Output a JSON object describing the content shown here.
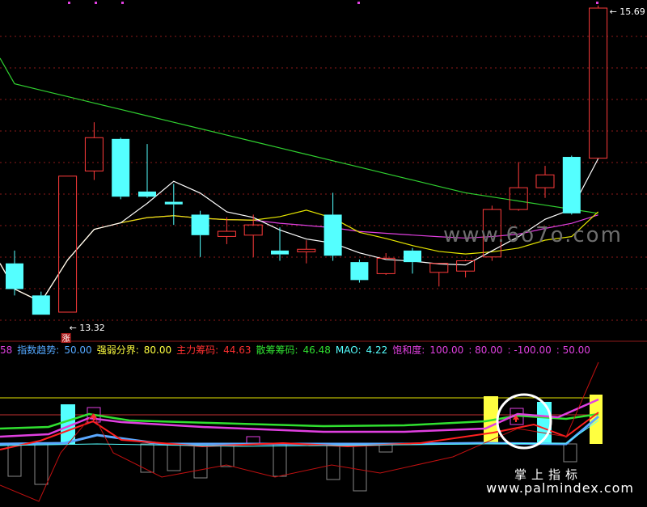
{
  "chart_data": [
    {
      "type": "candlestick",
      "title": "",
      "price_labels": {
        "high_marker": "15.69",
        "low_marker": "13.32"
      },
      "low_badge": "涨",
      "candles": [
        {
          "o": 13.7,
          "c": 13.5,
          "h": 13.8,
          "l": 13.45,
          "dir": "down"
        },
        {
          "o": 13.45,
          "c": 13.3,
          "h": 13.48,
          "l": 13.3,
          "dir": "down"
        },
        {
          "o": 13.32,
          "c": 14.38,
          "h": 14.38,
          "l": 13.32,
          "dir": "up"
        },
        {
          "o": 14.42,
          "c": 14.68,
          "h": 14.8,
          "l": 14.35,
          "dir": "up"
        },
        {
          "o": 14.67,
          "c": 14.22,
          "h": 14.68,
          "l": 14.2,
          "dir": "down"
        },
        {
          "o": 14.22,
          "c": 14.26,
          "h": 14.63,
          "l": 14.21,
          "dir": "down"
        },
        {
          "o": 14.18,
          "c": 14.16,
          "h": 14.32,
          "l": 14.0,
          "dir": "down"
        },
        {
          "o": 14.08,
          "c": 13.92,
          "h": 14.11,
          "l": 13.75,
          "dir": "down"
        },
        {
          "o": 13.91,
          "c": 13.95,
          "h": 14.06,
          "l": 13.85,
          "dir": "up"
        },
        {
          "o": 13.92,
          "c": 14.0,
          "h": 14.08,
          "l": 13.75,
          "dir": "up"
        },
        {
          "o": 13.8,
          "c": 13.77,
          "h": 13.98,
          "l": 13.72,
          "dir": "down"
        },
        {
          "o": 13.79,
          "c": 13.81,
          "h": 13.88,
          "l": 13.7,
          "dir": "up"
        },
        {
          "o": 14.08,
          "c": 13.76,
          "h": 14.25,
          "l": 13.72,
          "dir": "down"
        },
        {
          "o": 13.71,
          "c": 13.57,
          "h": 13.73,
          "l": 13.55,
          "dir": "down"
        },
        {
          "o": 13.62,
          "c": 13.74,
          "h": 13.78,
          "l": 13.61,
          "dir": "up"
        },
        {
          "o": 13.8,
          "c": 13.71,
          "h": 13.82,
          "l": 13.62,
          "dir": "down"
        },
        {
          "o": 13.63,
          "c": 13.7,
          "h": 13.7,
          "l": 13.52,
          "dir": "up"
        },
        {
          "o": 13.64,
          "c": 13.72,
          "h": 13.73,
          "l": 13.59,
          "dir": "up"
        },
        {
          "o": 13.75,
          "c": 14.12,
          "h": 14.15,
          "l": 13.72,
          "dir": "up"
        },
        {
          "o": 14.12,
          "c": 14.29,
          "h": 14.49,
          "l": 14.11,
          "dir": "up"
        },
        {
          "o": 14.29,
          "c": 14.39,
          "h": 14.46,
          "l": 14.21,
          "dir": "up"
        },
        {
          "o": 14.53,
          "c": 14.09,
          "h": 14.54,
          "l": 14.08,
          "dir": "down"
        },
        {
          "o": 14.52,
          "c": 15.69,
          "h": 15.71,
          "l": 14.52,
          "dir": "up"
        }
      ],
      "ma_colors": {
        "ma_white": "#ffffff",
        "ma_yellow": "#e6e600",
        "ma_magenta": "#e040e0",
        "ma_green": "#30d030"
      },
      "colors": {
        "up": "#ff3b3b",
        "down": "#54ffff",
        "grid": "#8b1a1a"
      }
    },
    {
      "type": "indicator",
      "legend": [
        {
          "text": "58",
          "color": "#e040e0"
        },
        {
          "text": "指数趋势:",
          "color": "#54a8ff"
        },
        {
          "text": "50.00",
          "color": "#54a8ff"
        },
        {
          "text": "强弱分界:",
          "color": "#ffff40"
        },
        {
          "text": "80.00",
          "color": "#ffff40"
        },
        {
          "text": "主力筹码:",
          "color": "#ff3030"
        },
        {
          "text": "44.63",
          "color": "#ff3030"
        },
        {
          "text": "散筹筹码:",
          "color": "#30e030"
        },
        {
          "text": "46.48",
          "color": "#30e030"
        },
        {
          "text": "MAO:",
          "color": "#54ffff"
        },
        {
          "text": "4.22",
          "color": "#54ffff"
        },
        {
          "text": "饱和度:",
          "color": "#e040e0"
        },
        {
          "text": "100.00",
          "color": "#e040e0"
        },
        {
          "text": ": 80.00",
          "color": "#e040e0"
        },
        {
          "text": ": -100.00",
          "color": "#e040e0"
        },
        {
          "text": ": 50.00",
          "color": "#e040e0"
        }
      ]
    }
  ],
  "watermarks": {
    "site": "www.palmindex.com",
    "brand": "掌上指标",
    "center": "www.6o7o.com"
  }
}
